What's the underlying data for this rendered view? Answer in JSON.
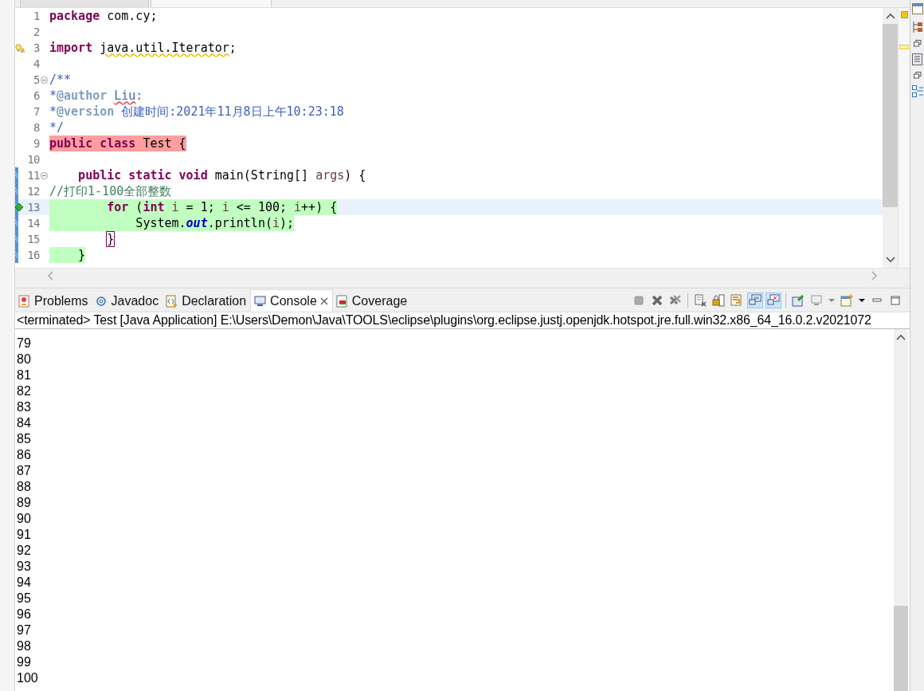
{
  "editor_tabs": [
    {
      "selected": false
    },
    {
      "selected": true
    }
  ],
  "editor": {
    "lines": [
      {
        "number": "1",
        "tokens": [
          {
            "text": "package ",
            "kind": "keyword"
          },
          {
            "text": "com.cy;",
            "kind": "plain"
          }
        ]
      },
      {
        "number": "2"
      },
      {
        "number": "3",
        "warning": true,
        "tokens": [
          {
            "text": "import ",
            "kind": "keyword"
          },
          {
            "text": "java.util.Iterator",
            "kind": "warning"
          },
          {
            "text": ";",
            "kind": "plain"
          }
        ]
      },
      {
        "number": "4"
      },
      {
        "number": "5",
        "fold": true,
        "tokens": [
          {
            "text": "/**",
            "kind": "javadoc"
          }
        ]
      },
      {
        "number": "6",
        "tokens": [
          {
            "text": "*",
            "kind": "javadoc"
          },
          {
            "text": "@author ",
            "kind": "javadoc-tag"
          },
          {
            "text": "Liu",
            "kind": "misspelled"
          },
          {
            "text": ":",
            "kind": "javadoc"
          }
        ]
      },
      {
        "number": "7",
        "tokens": [
          {
            "text": "*",
            "kind": "javadoc"
          },
          {
            "text": "@version",
            "kind": "javadoc-tag"
          },
          {
            "text": " 创建时间:2021年11月8日上午10:23:18",
            "kind": "javadoc"
          }
        ]
      },
      {
        "number": "8",
        "tokens": [
          {
            "text": "*/",
            "kind": "javadoc"
          }
        ]
      },
      {
        "number": "9",
        "not_covered": true,
        "tokens": [
          {
            "text": "public class ",
            "kind": "keyword"
          },
          {
            "text": "Test {",
            "kind": "plain"
          }
        ]
      },
      {
        "number": "10"
      },
      {
        "number": "11",
        "fold": true,
        "changed": true,
        "tokens": [
          {
            "text": "    public static void ",
            "kind": "keyword"
          },
          {
            "text": "main(String[] ",
            "kind": "plain"
          },
          {
            "text": "args",
            "kind": "variable"
          },
          {
            "text": ") {",
            "kind": "plain"
          }
        ]
      },
      {
        "number": "12",
        "changed": true,
        "tokens": [
          {
            "text": "//打印1-100全部整数",
            "kind": "comment"
          }
        ]
      },
      {
        "number": "13",
        "changed": true,
        "current": true,
        "diamond": true,
        "covered": true,
        "tokens": [
          {
            "text": "        for",
            "kind": "keyword"
          },
          {
            "text": " (",
            "kind": "plain"
          },
          {
            "text": "int ",
            "kind": "keyword"
          },
          {
            "text": "i",
            "kind": "variable"
          },
          {
            "text": " = 1; ",
            "kind": "plain"
          },
          {
            "text": "i",
            "kind": "variable"
          },
          {
            "text": " <= 100; ",
            "kind": "plain"
          },
          {
            "text": "i",
            "kind": "variable"
          },
          {
            "text": "++) {",
            "kind": "plain"
          }
        ]
      },
      {
        "number": "14",
        "changed": true,
        "covered": true,
        "tokens": [
          {
            "text": "            System.",
            "kind": "plain"
          },
          {
            "text": "out",
            "kind": "field"
          },
          {
            "text": ".println(",
            "kind": "plain"
          },
          {
            "text": "i",
            "kind": "variable"
          },
          {
            "text": ");",
            "kind": "plain"
          }
        ]
      },
      {
        "number": "15",
        "changed": true,
        "tokens": [
          {
            "text": "        }",
            "kind": "bracket-match"
          }
        ]
      },
      {
        "number": "16",
        "changed": true,
        "covered": true,
        "tokens": [
          {
            "text": "    }",
            "kind": "plain"
          }
        ]
      }
    ]
  },
  "panel": {
    "tabs": [
      {
        "label": "Problems",
        "selected": false
      },
      {
        "label": "Javadoc",
        "selected": false
      },
      {
        "label": "Declaration",
        "selected": false
      },
      {
        "label": "Console",
        "selected": true
      },
      {
        "label": "Coverage",
        "selected": false
      }
    ],
    "toolbar": [
      {
        "kind": "terminate",
        "pressed": false
      },
      {
        "kind": "remove",
        "pressed": false
      },
      {
        "kind": "remove-all",
        "pressed": false
      },
      {
        "kind": "clear",
        "pressed": false
      },
      {
        "kind": "scroll-lock",
        "pressed": false
      },
      {
        "kind": "word-wrap",
        "pressed": false
      },
      {
        "kind": "show-out",
        "pressed": true
      },
      {
        "kind": "show-err",
        "pressed": true
      },
      {
        "kind": "pin",
        "pressed": false
      },
      {
        "kind": "display",
        "pressed": false
      },
      {
        "kind": "new-console",
        "pressed": false
      },
      {
        "kind": "minimize",
        "pressed": false
      },
      {
        "kind": "maximize",
        "pressed": false
      }
    ],
    "console": {
      "header": "<terminated> Test [Java Application] E:\\Users\\Demon\\Java\\TOOLS\\eclipse\\plugins\\org.eclipse.justj.openjdk.hotspot.jre.full.win32.x86_64_16.0.2.v2021072",
      "output": [
        "79",
        "80",
        "81",
        "82",
        "83",
        "84",
        "85",
        "86",
        "87",
        "88",
        "89",
        "90",
        "91",
        "92",
        "93",
        "94",
        "95",
        "96",
        "97",
        "98",
        "99",
        "100"
      ]
    }
  }
}
